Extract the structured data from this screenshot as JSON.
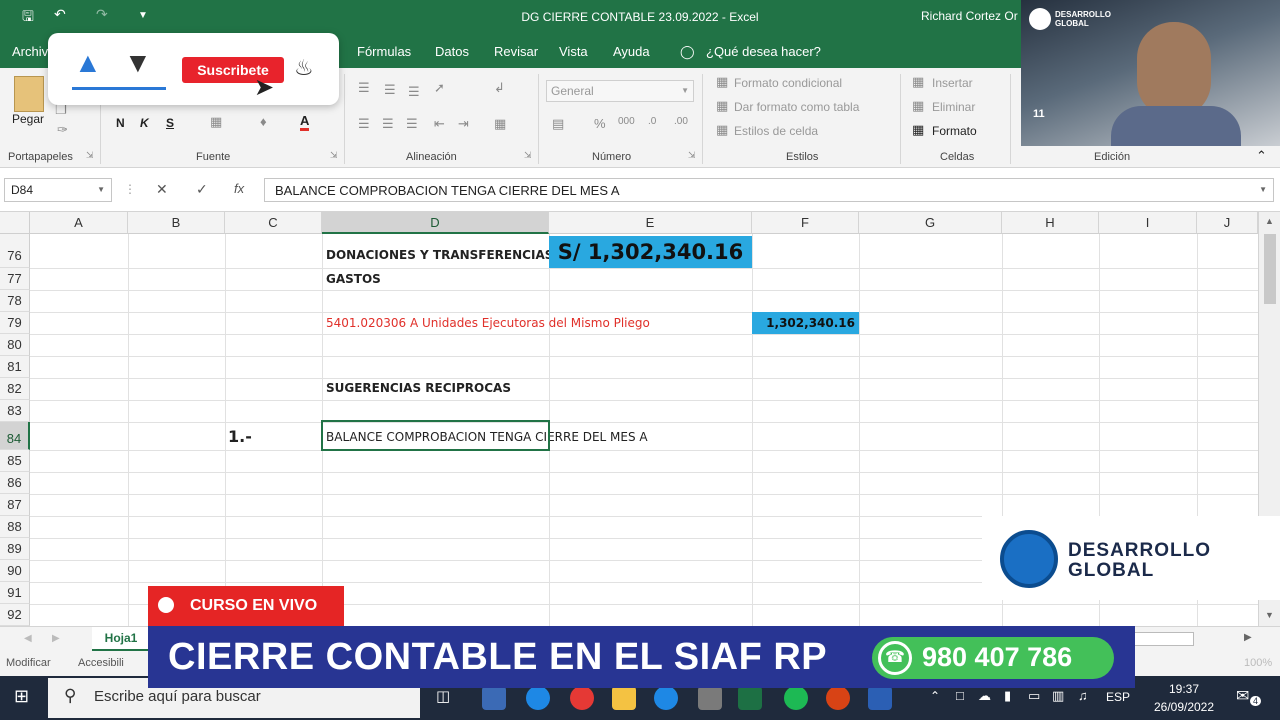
{
  "app": {
    "title": "DG CIERRE CONTABLE 23.09.2022  -  Excel",
    "user": "Richard Cortez Or"
  },
  "ribbon_tabs": [
    "Archivo",
    "Fórmulas",
    "Datos",
    "Revisar",
    "Vista",
    "Ayuda",
    "¿Qué desea hacer?"
  ],
  "ribbon": {
    "paste_label": "Pegar",
    "font_buttons": [
      "N",
      "K",
      "S"
    ],
    "number_format": "General",
    "styles": [
      "Formato condicional",
      "Dar formato como tabla",
      "Estilos de celda"
    ],
    "cells": [
      "Insertar",
      "Eliminar",
      "Formato"
    ],
    "groups": [
      "Portapapeles",
      "Fuente",
      "Alineación",
      "Número",
      "Estilos",
      "Celdas",
      "Edición"
    ]
  },
  "formula_bar": {
    "name_box": "D84",
    "cancel": "✕",
    "enter": "✓",
    "fx": "fx",
    "content": "BALANCE COMPROBACION TENGA CIERRE DEL MES A"
  },
  "columns": [
    "A",
    "B",
    "C",
    "D",
    "E",
    "F",
    "G",
    "H",
    "I",
    "J"
  ],
  "rows": [
    "76",
    "77",
    "78",
    "79",
    "80",
    "81",
    "82",
    "83",
    "84",
    "85",
    "86",
    "87",
    "88",
    "89",
    "90",
    "91",
    "92"
  ],
  "cells": {
    "D76": "DONACIONES Y TRANSFERENCIAS",
    "E76": "S/ 1,302,340.16",
    "D77": "GASTOS",
    "D79": "5401.020306 A Unidades Ejecutoras del Mismo Pliego",
    "F79": "1,302,340.16",
    "D82": "SUGERENCIAS RECIPROCAS",
    "C84": "1.-",
    "D84": "BALANCE COMPROBACION TENGA CIERRE DEL MES A"
  },
  "sheet": {
    "tab": "Hoja1",
    "status_left": "Modificar",
    "status_access": "Accesibili",
    "zoom": "100%"
  },
  "taskbar": {
    "search_placeholder": "Escribe aquí para buscar",
    "lang": "ESP",
    "time": "19:37",
    "date": "26/09/2022",
    "notifications": "4"
  },
  "overlay": {
    "subscribe": "Suscribete",
    "live": "CURSO EN VIVO",
    "headline": "CIERRE CONTABLE EN EL SIAF RP",
    "phone": "980 407 786",
    "brand_line1": "DESARROLLO",
    "brand_line2": "GLOBAL",
    "webcam_brand_line1": "DESARROLLO",
    "webcam_brand_line2": "GLOBAL",
    "webcam_badge": "11"
  },
  "colors": {
    "excel_green": "#217346",
    "highlight_blue": "#29a8e0",
    "red_text": "#e0302a",
    "banner_blue": "#283593",
    "whatsapp_green": "#43c059",
    "live_red": "#e52525"
  }
}
